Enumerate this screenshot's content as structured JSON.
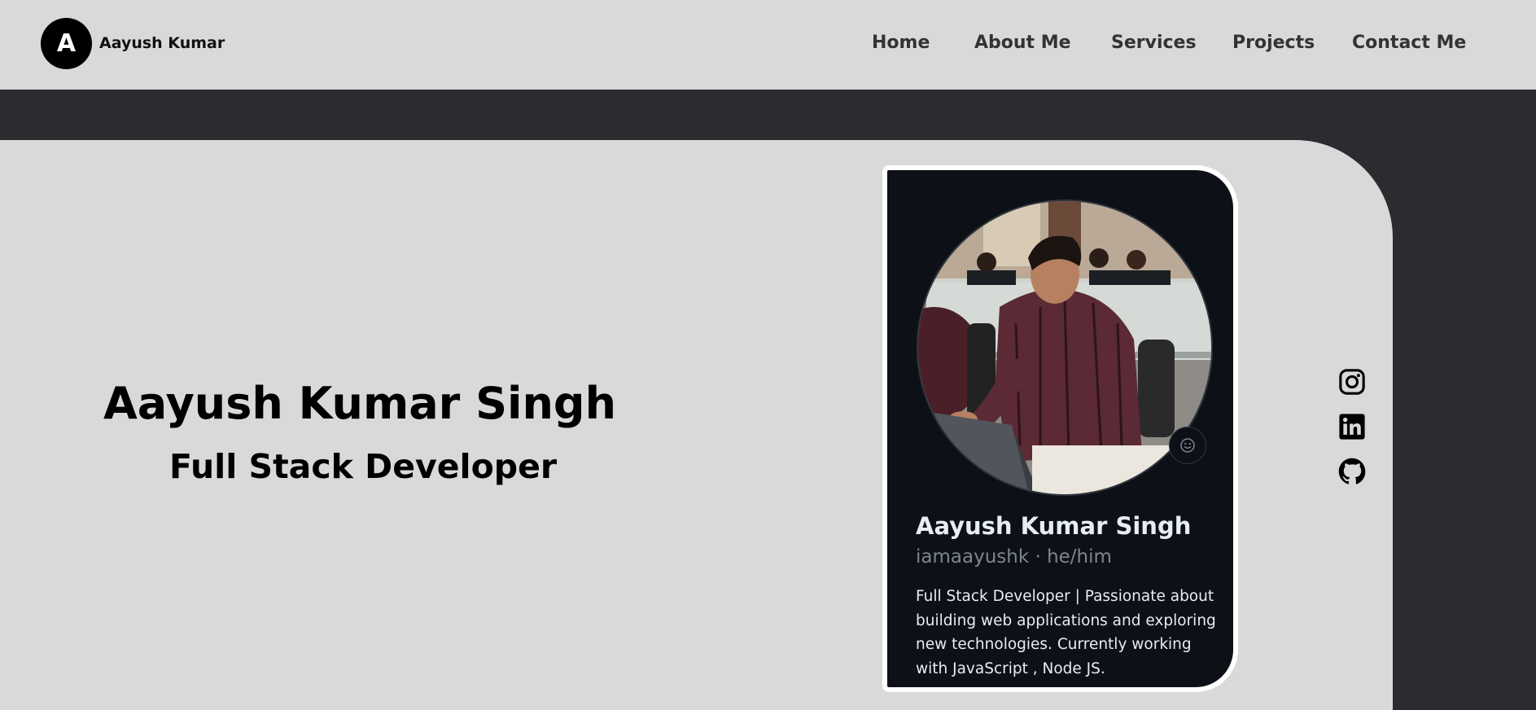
{
  "header": {
    "logo_letter": "A",
    "logo_name": "Aayush Kumar",
    "nav": [
      "Home",
      "About Me",
      "Services",
      "Projects",
      "Contact Me"
    ]
  },
  "hero": {
    "name": "Aayush Kumar Singh",
    "role": "Full Stack Developer"
  },
  "card": {
    "name": "Aayush Kumar Singh",
    "handle": "iamaayushk · he/him",
    "bio": "Full Stack Developer | Passionate about building web applications and exploring new technologies. Currently working with JavaScript , Node JS.",
    "photo_icon": "profile-photo",
    "status_icon": "smiley-icon"
  },
  "social": {
    "icons": [
      "instagram-icon",
      "linkedin-icon",
      "github-icon"
    ]
  },
  "colors": {
    "page_bg": "#2a2c30",
    "panel_bg": "#d9d9d9",
    "card_bg": "#0d1117",
    "card_border": "#ffffff"
  }
}
